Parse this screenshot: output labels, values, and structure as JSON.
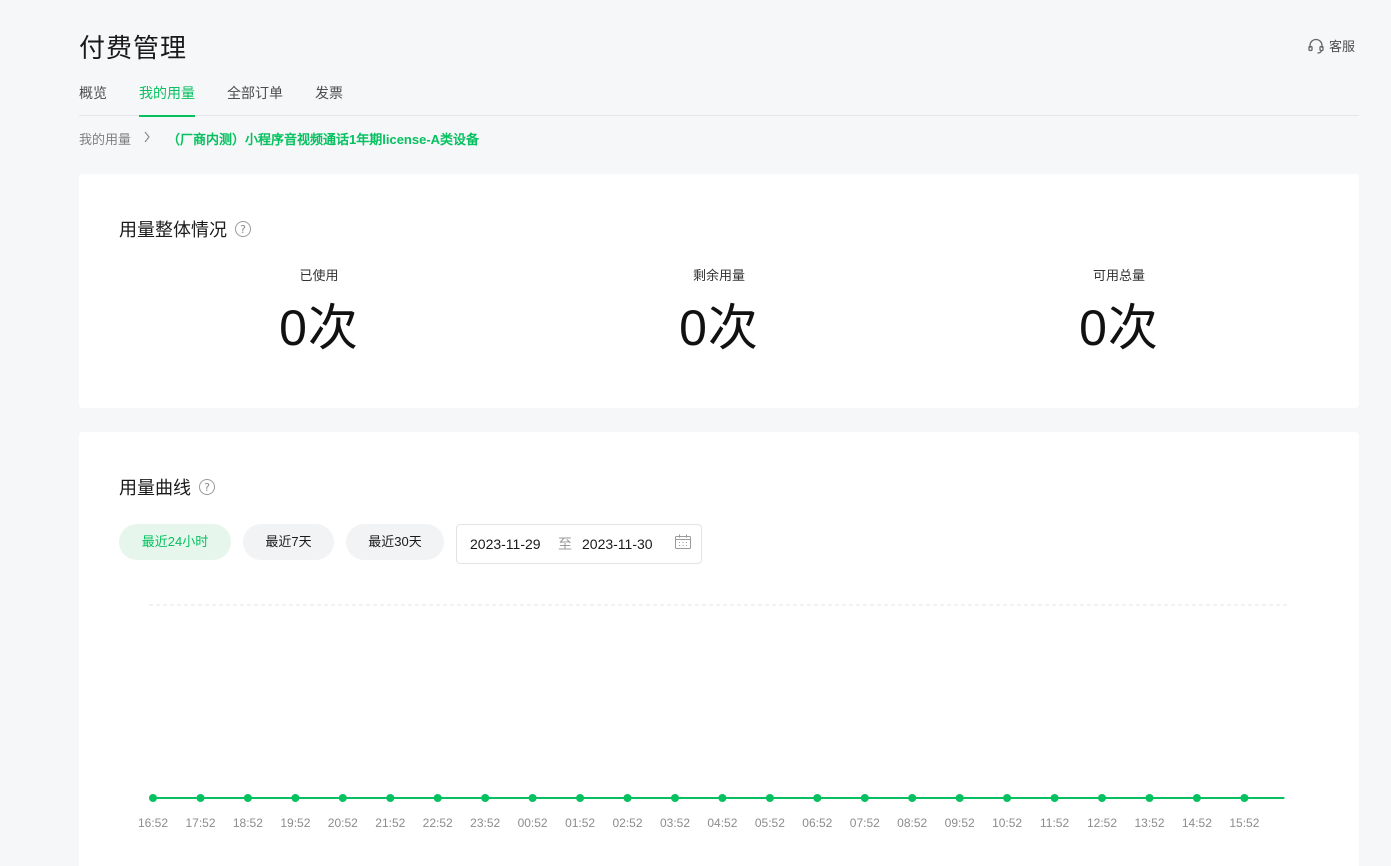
{
  "header": {
    "title": "付费管理",
    "service_label": "客服"
  },
  "tabs": [
    {
      "label": "概览"
    },
    {
      "label": "我的用量"
    },
    {
      "label": "全部订单"
    },
    {
      "label": "发票"
    }
  ],
  "breadcrumb": {
    "parent": "我的用量",
    "current": "（厂商内测）小程序音视频通话1年期license-A类设备"
  },
  "overview": {
    "title": "用量整体情况",
    "stats": [
      {
        "label": "已使用",
        "value": "0次"
      },
      {
        "label": "剩余用量",
        "value": "0次"
      },
      {
        "label": "可用总量",
        "value": "0次"
      }
    ]
  },
  "curve": {
    "title": "用量曲线",
    "ranges": [
      {
        "label": "最近24小时"
      },
      {
        "label": "最近7天"
      },
      {
        "label": "最近30天"
      }
    ],
    "date_start": "2023-11-29",
    "date_sep": "至",
    "date_end": "2023-11-30"
  },
  "colors": {
    "accent": "#07c160",
    "background": "#f6f7f9"
  },
  "chart_data": {
    "type": "line",
    "x": [
      "16:52",
      "17:52",
      "18:52",
      "19:52",
      "20:52",
      "21:52",
      "22:52",
      "23:52",
      "00:52",
      "01:52",
      "02:52",
      "03:52",
      "04:52",
      "05:52",
      "06:52",
      "07:52",
      "08:52",
      "09:52",
      "10:52",
      "11:52",
      "12:52",
      "13:52",
      "14:52",
      "15:52"
    ],
    "series": [
      {
        "values": [
          0,
          0,
          0,
          0,
          0,
          0,
          0,
          0,
          0,
          0,
          0,
          0,
          0,
          0,
          0,
          0,
          0,
          0,
          0,
          0,
          0,
          0,
          0,
          0
        ]
      }
    ],
    "ylim": [
      0,
      1
    ],
    "grid": true,
    "color": "#07c160"
  }
}
